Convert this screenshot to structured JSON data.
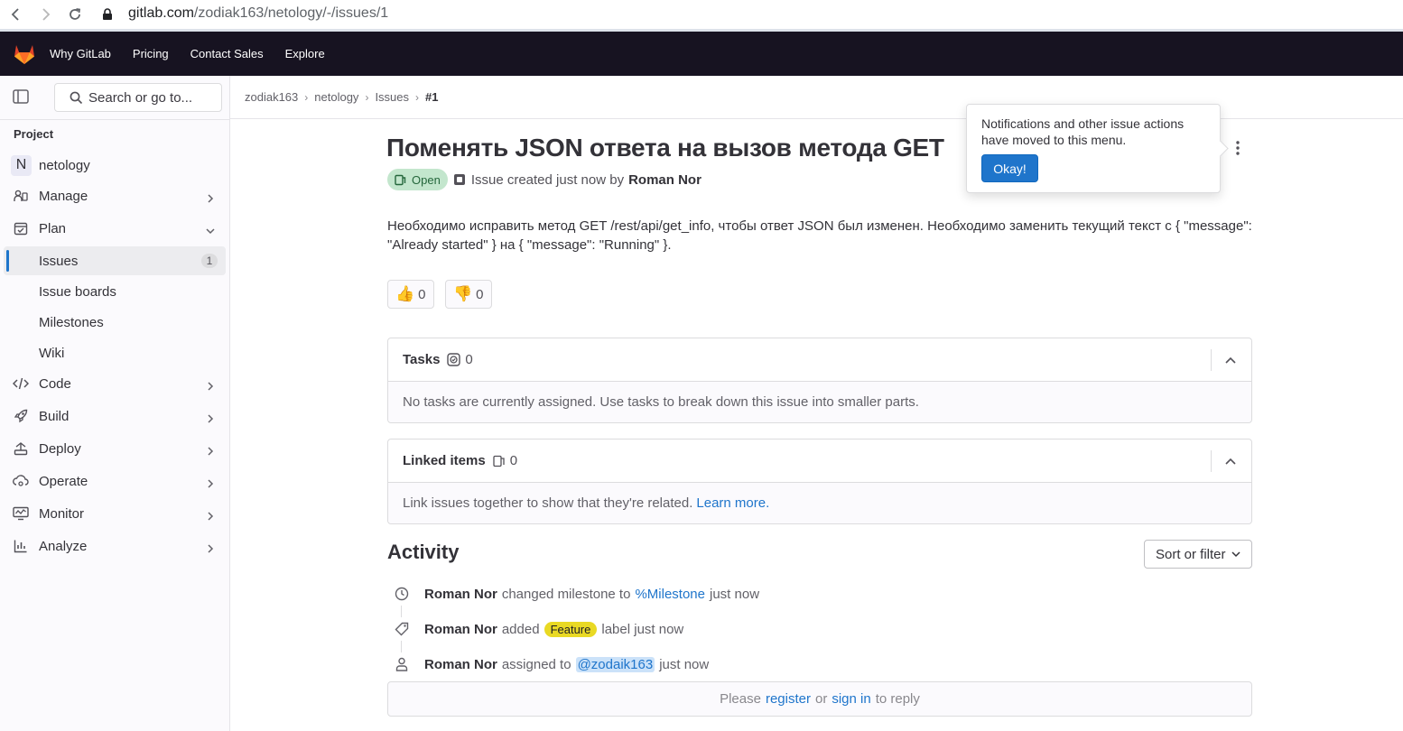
{
  "browser": {
    "url_host": "gitlab.com",
    "url_path": "/zodiak163/netology/-/issues/1"
  },
  "topnav": {
    "items": [
      "Why GitLab",
      "Pricing",
      "Contact Sales",
      "Explore"
    ]
  },
  "sidebar": {
    "search_label": "Search or go to...",
    "section_heading": "Project",
    "project_name": "netology",
    "project_initial": "N",
    "items": {
      "manage": "Manage",
      "plan": "Plan",
      "issues": "Issues",
      "issues_count": "1",
      "issue_boards": "Issue boards",
      "milestones": "Milestones",
      "wiki": "Wiki",
      "code": "Code",
      "build": "Build",
      "deploy": "Deploy",
      "operate": "Operate",
      "monitor": "Monitor",
      "analyze": "Analyze"
    }
  },
  "breadcrumb": [
    "zodiak163",
    "netology",
    "Issues",
    "#1"
  ],
  "issue": {
    "title": "Поменять JSON ответа на вызов метода GET",
    "status": "Open",
    "created_text": "Issue created just now by",
    "author": "Roman Nor",
    "description": "Необходимо исправить метод GET /rest/api/get_info, чтобы ответ JSON был изменен. Необходимо заменить текущий текст с { \"message\": \"Already started\" } на { \"message\": \"Running\" }.",
    "thumbs_up_count": "0",
    "thumbs_down_count": "0"
  },
  "tasks": {
    "title": "Tasks",
    "count": "0",
    "empty_text": "No tasks are currently assigned. Use tasks to break down this issue into smaller parts."
  },
  "linked": {
    "title": "Linked items",
    "count": "0",
    "empty_text": "Link issues together to show that they're related.",
    "learn_more": "Learn more."
  },
  "activity": {
    "title": "Activity",
    "sort_label": "Sort or filter",
    "notes": [
      {
        "author": "Roman Nor",
        "action": "changed milestone to",
        "target": "%Milestone",
        "time": "just now"
      },
      {
        "author": "Roman Nor",
        "action": "added",
        "label": "Feature",
        "suffix": "label just now"
      },
      {
        "author": "Roman Nor",
        "action": "assigned to",
        "mention": "@zodaik163",
        "time": "just now"
      }
    ]
  },
  "reply": {
    "please": "Please",
    "register": "register",
    "or": "or",
    "sign_in": "sign in",
    "to_reply": "to reply"
  },
  "popover": {
    "text": "Notifications and other issue actions have moved to this menu.",
    "ok_label": "Okay!"
  },
  "colors": {
    "topnav_bg": "#171321",
    "accent": "#1f75cb",
    "open_badge_bg": "#c3e6cd",
    "feature_label": "#e9d924"
  }
}
